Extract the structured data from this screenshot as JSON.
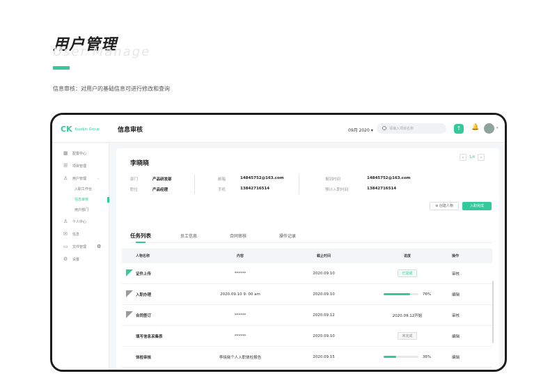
{
  "hero": {
    "title": "用户管理",
    "subtitle": "User Manage",
    "description": "信息审核：对用户的基础信息可进行修改和查询"
  },
  "app": {
    "logo_mark": "CK",
    "logo_text": "Kuudjin Group",
    "page_title": "信息审核",
    "date_select": "09月 2020",
    "search_placeholder": "请输入项目名称",
    "accent": "#33c99a"
  },
  "sidebar": {
    "items": [
      {
        "label": "配置中心",
        "icon": "grid-icon"
      },
      {
        "label": "项目管理",
        "icon": "list-icon"
      },
      {
        "label": "用户管理",
        "icon": "user-icon"
      },
      {
        "label": "个人中心",
        "icon": "person-icon"
      },
      {
        "label": "信息",
        "icon": "mail-icon"
      },
      {
        "label": "文件管理",
        "icon": "folder-icon"
      },
      {
        "label": "设置",
        "icon": "gear-icon"
      }
    ],
    "subitems": [
      {
        "label": "入职工作台",
        "active": false
      },
      {
        "label": "信息审核",
        "active": true
      },
      {
        "label": "用户部门",
        "active": false
      }
    ]
  },
  "profile": {
    "name": "李晓晓",
    "pager": "1/4",
    "dept_label": "部门",
    "dept": "产品研发部",
    "position_label": "职位",
    "position": "产品经理",
    "email_label": "邮箱",
    "email": "14845752@163.com",
    "phone_label": "手机",
    "phone": "13842716514",
    "report_label": "报到时间",
    "report": "14845752@163.com",
    "expected_label": "预计入职时间",
    "expected": "13842716514",
    "btn_create": "创建人物",
    "btn_entry": "入职完成"
  },
  "tabs": [
    "任务列表",
    "员工信息",
    "合同审核",
    "操作记录"
  ],
  "table": {
    "headers": [
      "人物名称",
      "内容",
      "截止时间",
      "进度",
      "操作"
    ],
    "rows": [
      {
        "name": "证件上传",
        "content": "******",
        "deadline": "2020.09.10",
        "progress_type": "tag",
        "progress_text": "已完成",
        "tag_style": "green",
        "action": "审核",
        "flag": "green"
      },
      {
        "name": "入职办理",
        "content": "2020.09.10 9: 00 am",
        "deadline": "2020.09.10",
        "progress_type": "bar",
        "progress_value": 0.76,
        "progress_text": "76%",
        "action": "编辑",
        "flag": "gray"
      },
      {
        "name": "合同签订",
        "content": "******",
        "deadline": "2020.09.12",
        "progress_type": "text",
        "progress_text": "2020.09.12开始",
        "action": "审核",
        "flag": "gray"
      },
      {
        "name": "填写信息采集表",
        "content": "******",
        "deadline": "2020.09.10",
        "progress_type": "tag",
        "progress_text": "未完成",
        "tag_style": "gray",
        "action": "编辑",
        "flag": "none"
      },
      {
        "name": "体检审核",
        "content": "李晓晓个人入职体检报告",
        "deadline": "2020.09.15",
        "progress_type": "bar",
        "progress_value": 0.36,
        "progress_text": "36%",
        "action": "编辑",
        "flag": "none"
      }
    ]
  }
}
